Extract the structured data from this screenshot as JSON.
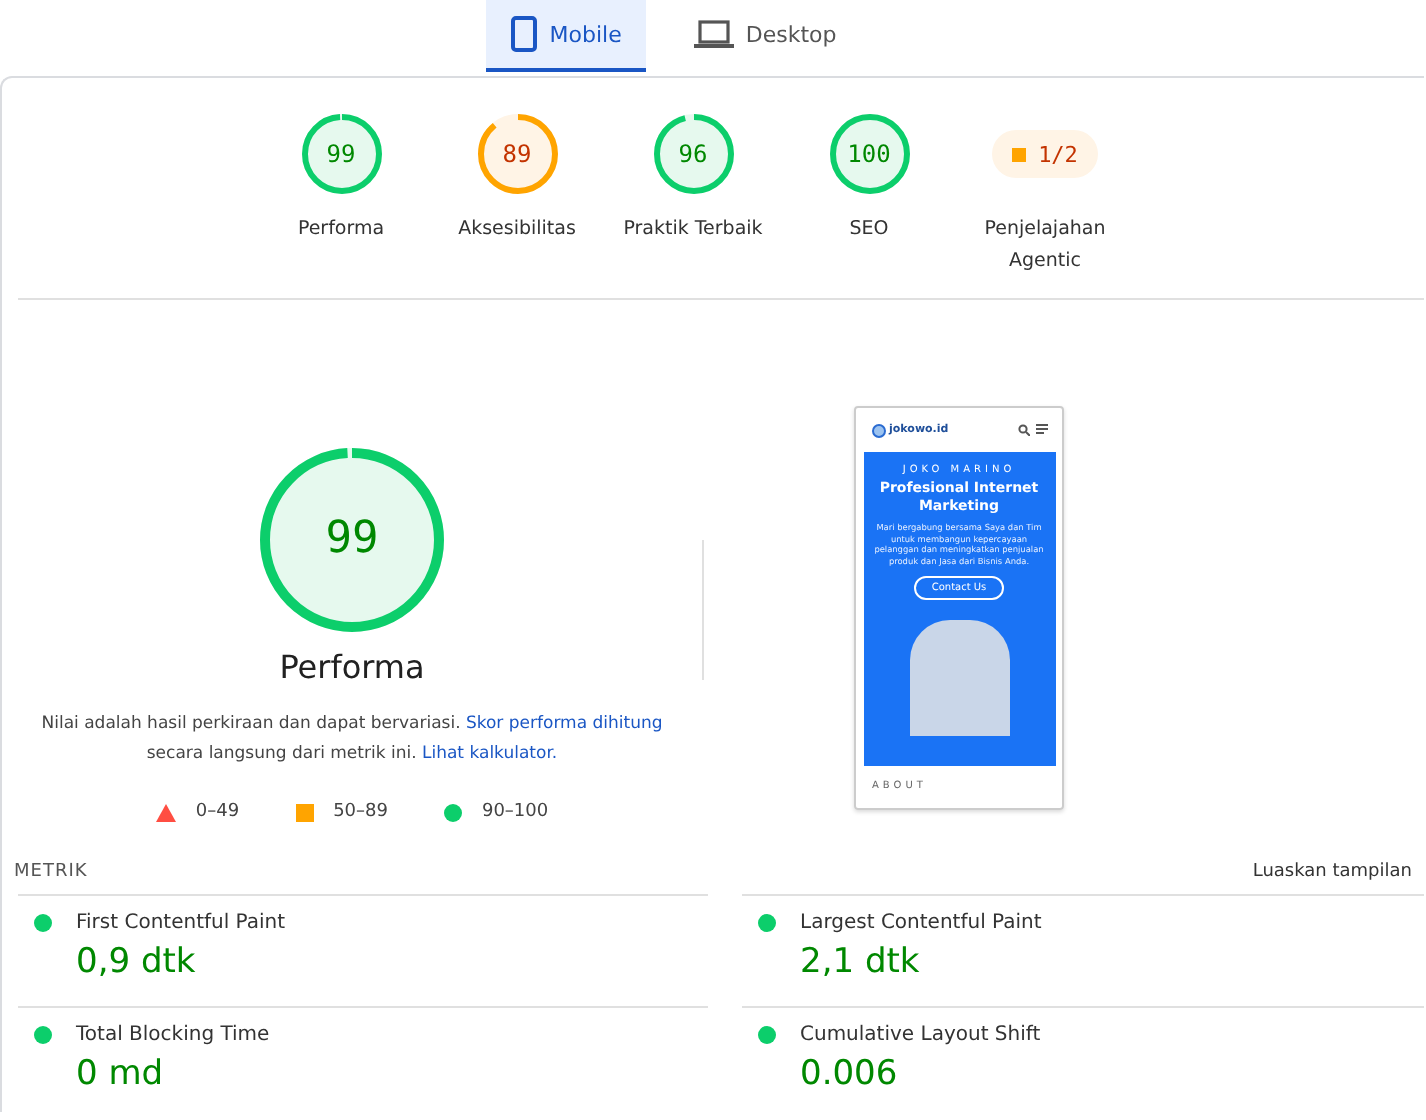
{
  "tabs": [
    {
      "label": "Mobile",
      "selected": true
    },
    {
      "label": "Desktop",
      "selected": false
    }
  ],
  "categories": [
    {
      "kind": "gauge",
      "score": "99",
      "level": 0.99,
      "color": "#0cce6b",
      "label": "Performa"
    },
    {
      "kind": "gauge",
      "score": "89",
      "level": 0.89,
      "color": "#ffa400",
      "label": "Aksesibilitas"
    },
    {
      "kind": "gauge",
      "score": "96",
      "level": 0.96,
      "color": "#0cce6b",
      "label": "Praktik Terbaik"
    },
    {
      "kind": "gauge",
      "score": "100",
      "level": 1,
      "color": "#0cce6b",
      "label": "SEO"
    },
    {
      "kind": "fraction",
      "score": "1/2",
      "color": "#ffa400",
      "label": "Penjelajahan Agentic"
    }
  ],
  "performance": {
    "score": "99",
    "level": 0.99,
    "title": "Performa",
    "note": "Nilai adalah hasil perkiraan dan dapat bervariasi. ",
    "link1": "Skor performa dihitung",
    "note2": " secara langsung dari metrik ini. ",
    "link2": "Lihat kalkulator.",
    "legend": [
      {
        "kind": "triangle",
        "color": "#ff4e42",
        "label": "0–49"
      },
      {
        "kind": "square",
        "color": "#ffa400",
        "label": "50–89"
      },
      {
        "kind": "circle",
        "color": "#0cce6b",
        "label": "90–100"
      }
    ]
  },
  "preview": {
    "logo": "jokowo.id",
    "kicker": "JOKO MARINO",
    "headline": "Profesional Internet Marketing",
    "body": "Mari bergabung bersama Saya dan Tim untuk membangun kepercayaan pelanggan dan meningkatkan penjualan produk dan Jasa dari Bisnis Anda.",
    "button": "Contact Us",
    "section": "ABOUT"
  },
  "metrics_header": {
    "title": "METRIK",
    "toggle": "Luaskan tampilan"
  },
  "metrics": [
    {
      "name": "First Contentful Paint",
      "value": "0,9 dtk",
      "color": "#0cce6b"
    },
    {
      "name": "Largest Contentful Paint",
      "value": "2,1 dtk",
      "color": "#0cce6b"
    },
    {
      "name": "Total Blocking Time",
      "value": "0 md",
      "color": "#0cce6b"
    },
    {
      "name": "Cumulative Layout Shift",
      "value": "0.006",
      "color": "#0cce6b"
    }
  ]
}
